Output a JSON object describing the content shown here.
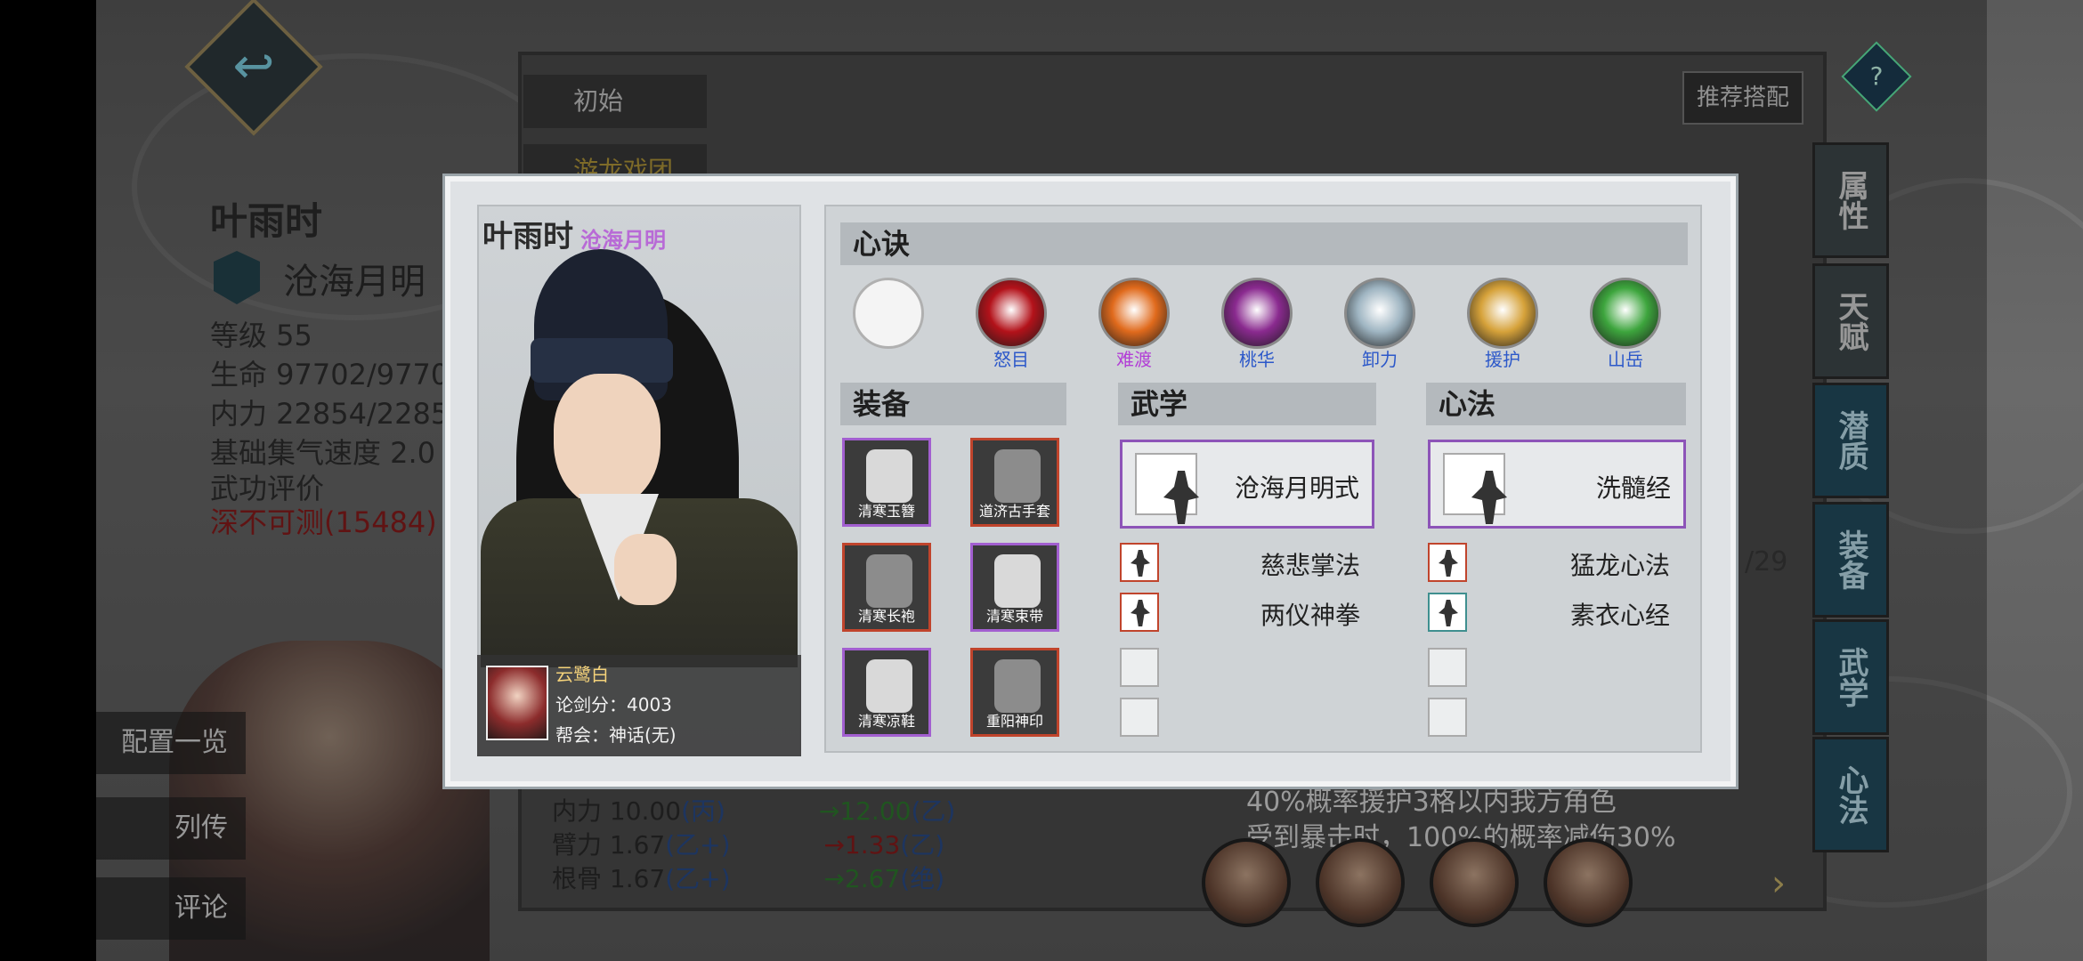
{
  "background": {
    "character_name": "叶雨时",
    "character_title": "沧海月明",
    "level": "等级 55",
    "hp": "生命 97702/9770",
    "mp": "内力 22854/2285",
    "qi_speed": "基础集气速度 2.0",
    "eval_label": "武功评价",
    "eval_value": "深不可测(15484)",
    "tab_initial": "初始",
    "tab_troupe": "游龙戏团",
    "recommend_button": "推荐搭配",
    "help_label": "?",
    "left_buttons": [
      "配置一览",
      "列传",
      "评论"
    ],
    "side_tabs": [
      "属性",
      "天赋",
      "潜质",
      "装备",
      "武学",
      "心法"
    ],
    "partial_counter": "/29",
    "stats": [
      {
        "label": "内力 10.00",
        "grade": "(丙)",
        "after": "→12.00",
        "after_grade": "(乙)"
      },
      {
        "label": "臂力 1.67",
        "grade": "(乙+)",
        "after": "→1.33",
        "after_grade": "(乙)"
      },
      {
        "label": "根骨 1.67",
        "grade": "(乙+)",
        "after": "→2.67",
        "after_grade": "(绝)"
      }
    ],
    "skill_text_1": "40%概率援护3格以内我方角色",
    "skill_text_2": "受到暴击时，100%的概率减伤30%"
  },
  "card": {
    "name": "叶雨时",
    "title": "沧海月明",
    "owner_name": "云鹭白",
    "sword_score": "论剑分：4003",
    "guild": "帮会：神话(无)"
  },
  "xinjue": {
    "header": "心诀",
    "slots": [
      {
        "label": "",
        "color": "#f4f4f4",
        "empty": true
      },
      {
        "label": "怒目",
        "color": "#b3121a",
        "text_color": "#2c58c9"
      },
      {
        "label": "难渡",
        "color": "#e06a1c",
        "text_color": "#b23fd6"
      },
      {
        "label": "桃华",
        "color": "#8a2a8f",
        "text_color": "#2c58c9"
      },
      {
        "label": "卸力",
        "color": "#9fb5c2",
        "text_color": "#2c58c9"
      },
      {
        "label": "援护",
        "color": "#d6a23a",
        "text_color": "#2c58c9"
      },
      {
        "label": "山岳",
        "color": "#3da53d",
        "text_color": "#2c58c9"
      }
    ]
  },
  "equipment": {
    "header": "装备",
    "items": [
      {
        "label": "清寒玉簪",
        "rarity": "purple",
        "icon": "hairpin-icon"
      },
      {
        "label": "道济古手套",
        "rarity": "red",
        "icon": "glove-icon"
      },
      {
        "label": "清寒长袍",
        "rarity": "red",
        "icon": "robe-icon"
      },
      {
        "label": "清寒束带",
        "rarity": "purple",
        "icon": "belt-icon"
      },
      {
        "label": "清寒凉鞋",
        "rarity": "purple",
        "icon": "boots-icon"
      },
      {
        "label": "重阳神印",
        "rarity": "red",
        "icon": "seal-icon"
      }
    ]
  },
  "martial": {
    "header": "武学",
    "main": "沧海月明式",
    "list": [
      "慈悲掌法",
      "两仪神拳"
    ]
  },
  "mind": {
    "header": "心法",
    "main": "洗髓经",
    "list": [
      "猛龙心法",
      "素衣心经"
    ]
  },
  "colors": {
    "purple": "#a25fd0",
    "red": "#c0442c",
    "title_purple": "#b86ad6"
  }
}
